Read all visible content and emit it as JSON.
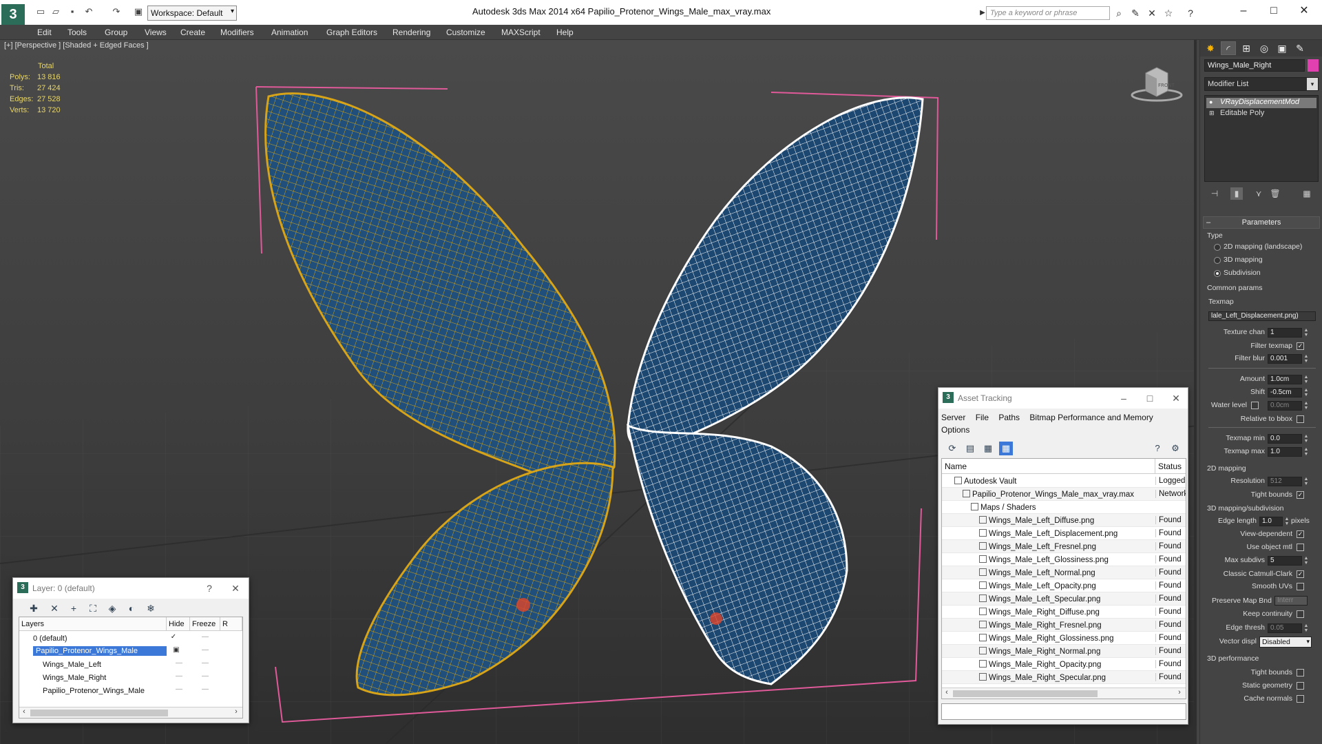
{
  "app": {
    "title": "Autodesk 3ds Max  2014 x64     Papilio_Protenor_Wings_Male_max_vray.max",
    "workspace": "Workspace: Default",
    "search_placeholder": "Type a keyword or phrase",
    "logo_glyph": "3"
  },
  "menu": [
    "Edit",
    "Tools",
    "Group",
    "Views",
    "Create",
    "Modifiers",
    "Animation",
    "Graph Editors",
    "Rendering",
    "Customize",
    "MAXScript",
    "Help"
  ],
  "viewport": {
    "label": "[+] [Perspective ] [Shaded + Edged Faces ]",
    "stats": {
      "header": "Total",
      "rows": [
        {
          "k": "Polys:",
          "v": "13 816"
        },
        {
          "k": "Tris:",
          "v": "27 424"
        },
        {
          "k": "Edges:",
          "v": "27 528"
        },
        {
          "k": "Verts:",
          "v": "13 720"
        }
      ]
    },
    "viewcube_label": "FRONT"
  },
  "layer_window": {
    "title": "Layer: 0 (default)",
    "help": "?",
    "close": "✕",
    "columns": {
      "layers": "Layers",
      "hide": "Hide",
      "freeze": "Freeze",
      "extra": "R"
    },
    "rows": [
      {
        "name": "0 (default)",
        "indent": 1,
        "mark": "✓"
      },
      {
        "name": "Papilio_Protenor_Wings_Male",
        "indent": 1,
        "selected": true
      },
      {
        "name": "Wings_Male_Left",
        "indent": 2
      },
      {
        "name": "Wings_Male_Right",
        "indent": 2
      },
      {
        "name": "Papilio_Protenor_Wings_Male",
        "indent": 2
      }
    ],
    "dash": "—"
  },
  "asset_window": {
    "title": "Asset Tracking",
    "menu": [
      "Server",
      "File",
      "Paths",
      "Bitmap Performance and Memory",
      "Options"
    ],
    "col_name": "Name",
    "col_status": "Status",
    "rows": [
      {
        "name": "Autodesk Vault",
        "status": "Logged",
        "indent": 1
      },
      {
        "name": "Papilio_Protenor_Wings_Male_max_vray.max",
        "status": "Network",
        "indent": 2
      },
      {
        "name": "Maps / Shaders",
        "status": "",
        "indent": 3
      },
      {
        "name": "Wings_Male_Left_Diffuse.png",
        "status": "Found",
        "indent": 4
      },
      {
        "name": "Wings_Male_Left_Displacement.png",
        "status": "Found",
        "indent": 4
      },
      {
        "name": "Wings_Male_Left_Fresnel.png",
        "status": "Found",
        "indent": 4
      },
      {
        "name": "Wings_Male_Left_Glossiness.png",
        "status": "Found",
        "indent": 4
      },
      {
        "name": "Wings_Male_Left_Normal.png",
        "status": "Found",
        "indent": 4
      },
      {
        "name": "Wings_Male_Left_Opacity.png",
        "status": "Found",
        "indent": 4
      },
      {
        "name": "Wings_Male_Left_Specular.png",
        "status": "Found",
        "indent": 4
      },
      {
        "name": "Wings_Male_Right_Diffuse.png",
        "status": "Found",
        "indent": 4
      },
      {
        "name": "Wings_Male_Right_Fresnel.png",
        "status": "Found",
        "indent": 4
      },
      {
        "name": "Wings_Male_Right_Glossiness.png",
        "status": "Found",
        "indent": 4
      },
      {
        "name": "Wings_Male_Right_Normal.png",
        "status": "Found",
        "indent": 4
      },
      {
        "name": "Wings_Male_Right_Opacity.png",
        "status": "Found",
        "indent": 4
      },
      {
        "name": "Wings_Male_Right_Specular.png",
        "status": "Found",
        "indent": 4
      }
    ]
  },
  "command_panel": {
    "object_name": "Wings_Male_Right",
    "object_color": "#e040b0",
    "modifier_list": "Modifier List",
    "stack": [
      {
        "name": "VRayDisplacementMod",
        "selected": true
      },
      {
        "name": "Editable Poly",
        "selected": false
      }
    ],
    "parameters": {
      "rollout": "Parameters",
      "type_group": "Type",
      "types": [
        {
          "label": "2D mapping (landscape)",
          "on": false
        },
        {
          "label": "3D mapping",
          "on": false
        },
        {
          "label": "Subdivision",
          "on": true
        }
      ],
      "common_group": "Common params",
      "texmap_label": "Texmap",
      "texmap_value": "lale_Left_Displacement.png)",
      "texture_chan_label": "Texture chan",
      "texture_chan": "1",
      "filter_texmap_label": "Filter texmap",
      "filter_blur_label": "Filter blur",
      "filter_blur": "0.001",
      "amount_label": "Amount",
      "amount": "1.0cm",
      "shift_label": "Shift",
      "shift": "-0.5cm",
      "water_label": "Water level",
      "water": "0.0cm",
      "relative_label": "Relative to bbox",
      "texmap_min_label": "Texmap min",
      "texmap_min": "0.0",
      "texmap_max_label": "Texmap max",
      "texmap_max": "1.0",
      "mapping2d_group": "2D mapping",
      "resolution_label": "Resolution",
      "resolution": "512",
      "tight_label": "Tight bounds",
      "subdiv_group": "3D mapping/subdivision",
      "edge_length_label": "Edge length",
      "edge_length": "1.0",
      "pixels_label": "pixels",
      "view_dep_label": "View-dependent",
      "use_obj_label": "Use object mtl",
      "max_subdivs_label": "Max subdivs",
      "max_subdivs": "5",
      "catmull_label": "Classic Catmull-Clark",
      "smooth_uv_label": "Smooth UVs",
      "preserve_label": "Preserve Map Bnd",
      "preserve_value": "Interr",
      "keep_cont_label": "Keep continuity",
      "edge_thresh_label": "Edge thresh",
      "edge_thresh": "0.05",
      "vector_label": "Vector displ",
      "vector_value": "Disabled",
      "perf_group": "3D performance",
      "perf_tight_label": "Tight bounds",
      "static_geo_label": "Static geometry",
      "cache_normals_label": "Cache normals"
    }
  },
  "colors": {
    "left_wire": "#d7a419",
    "right_wire": "#ffffff",
    "wing_blue": "#1f4f7a",
    "bbox": "#e05a9a"
  }
}
